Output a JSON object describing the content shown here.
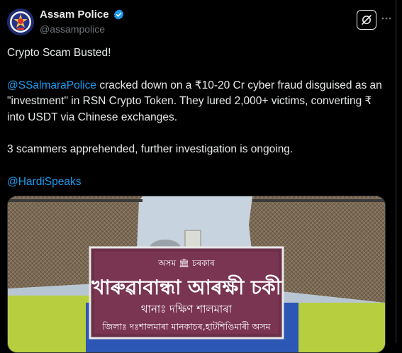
{
  "account": {
    "display_name": "Assam Police",
    "handle": "@assampolice",
    "verified_icon": "verified-badge-icon",
    "avatar_icon": "assam-police-emblem-icon"
  },
  "actions": {
    "grok_icon": "grok-icon",
    "more_icon": "more-options-icon"
  },
  "tweet": {
    "headline": "Crypto Scam Busted!",
    "mention_1": "@SSalmaraPolice",
    "body_1": " cracked down on a ₹10-20 Cr cyber fraud disguised as an \"investment\" in RSN Crypto Token. They lured 2,000+ victims, converting ₹ into USDT via Chinese exchanges.",
    "body_2": "3 scammers apprehended, further investigation is ongoing.",
    "mention_2": "@HardiSpeaks"
  },
  "media": {
    "sign_line_1": "অসম 🏛 চৰকাৰ",
    "sign_line_2": "খাৰুৱাবান্ধা আৰক্ষী চকী",
    "sign_line_3": "থানাঃ দক্ষিণ শালমাৰা",
    "sign_line_4": "জিলাঃ দঃশালমাৰা মানকাচৰ,হাটশিঙিমাৰী অসম"
  },
  "colors": {
    "background": "#000000",
    "text": "#e7e9ea",
    "muted": "#71767b",
    "link": "#1d9bf0",
    "verified": "#1d9bf0"
  }
}
